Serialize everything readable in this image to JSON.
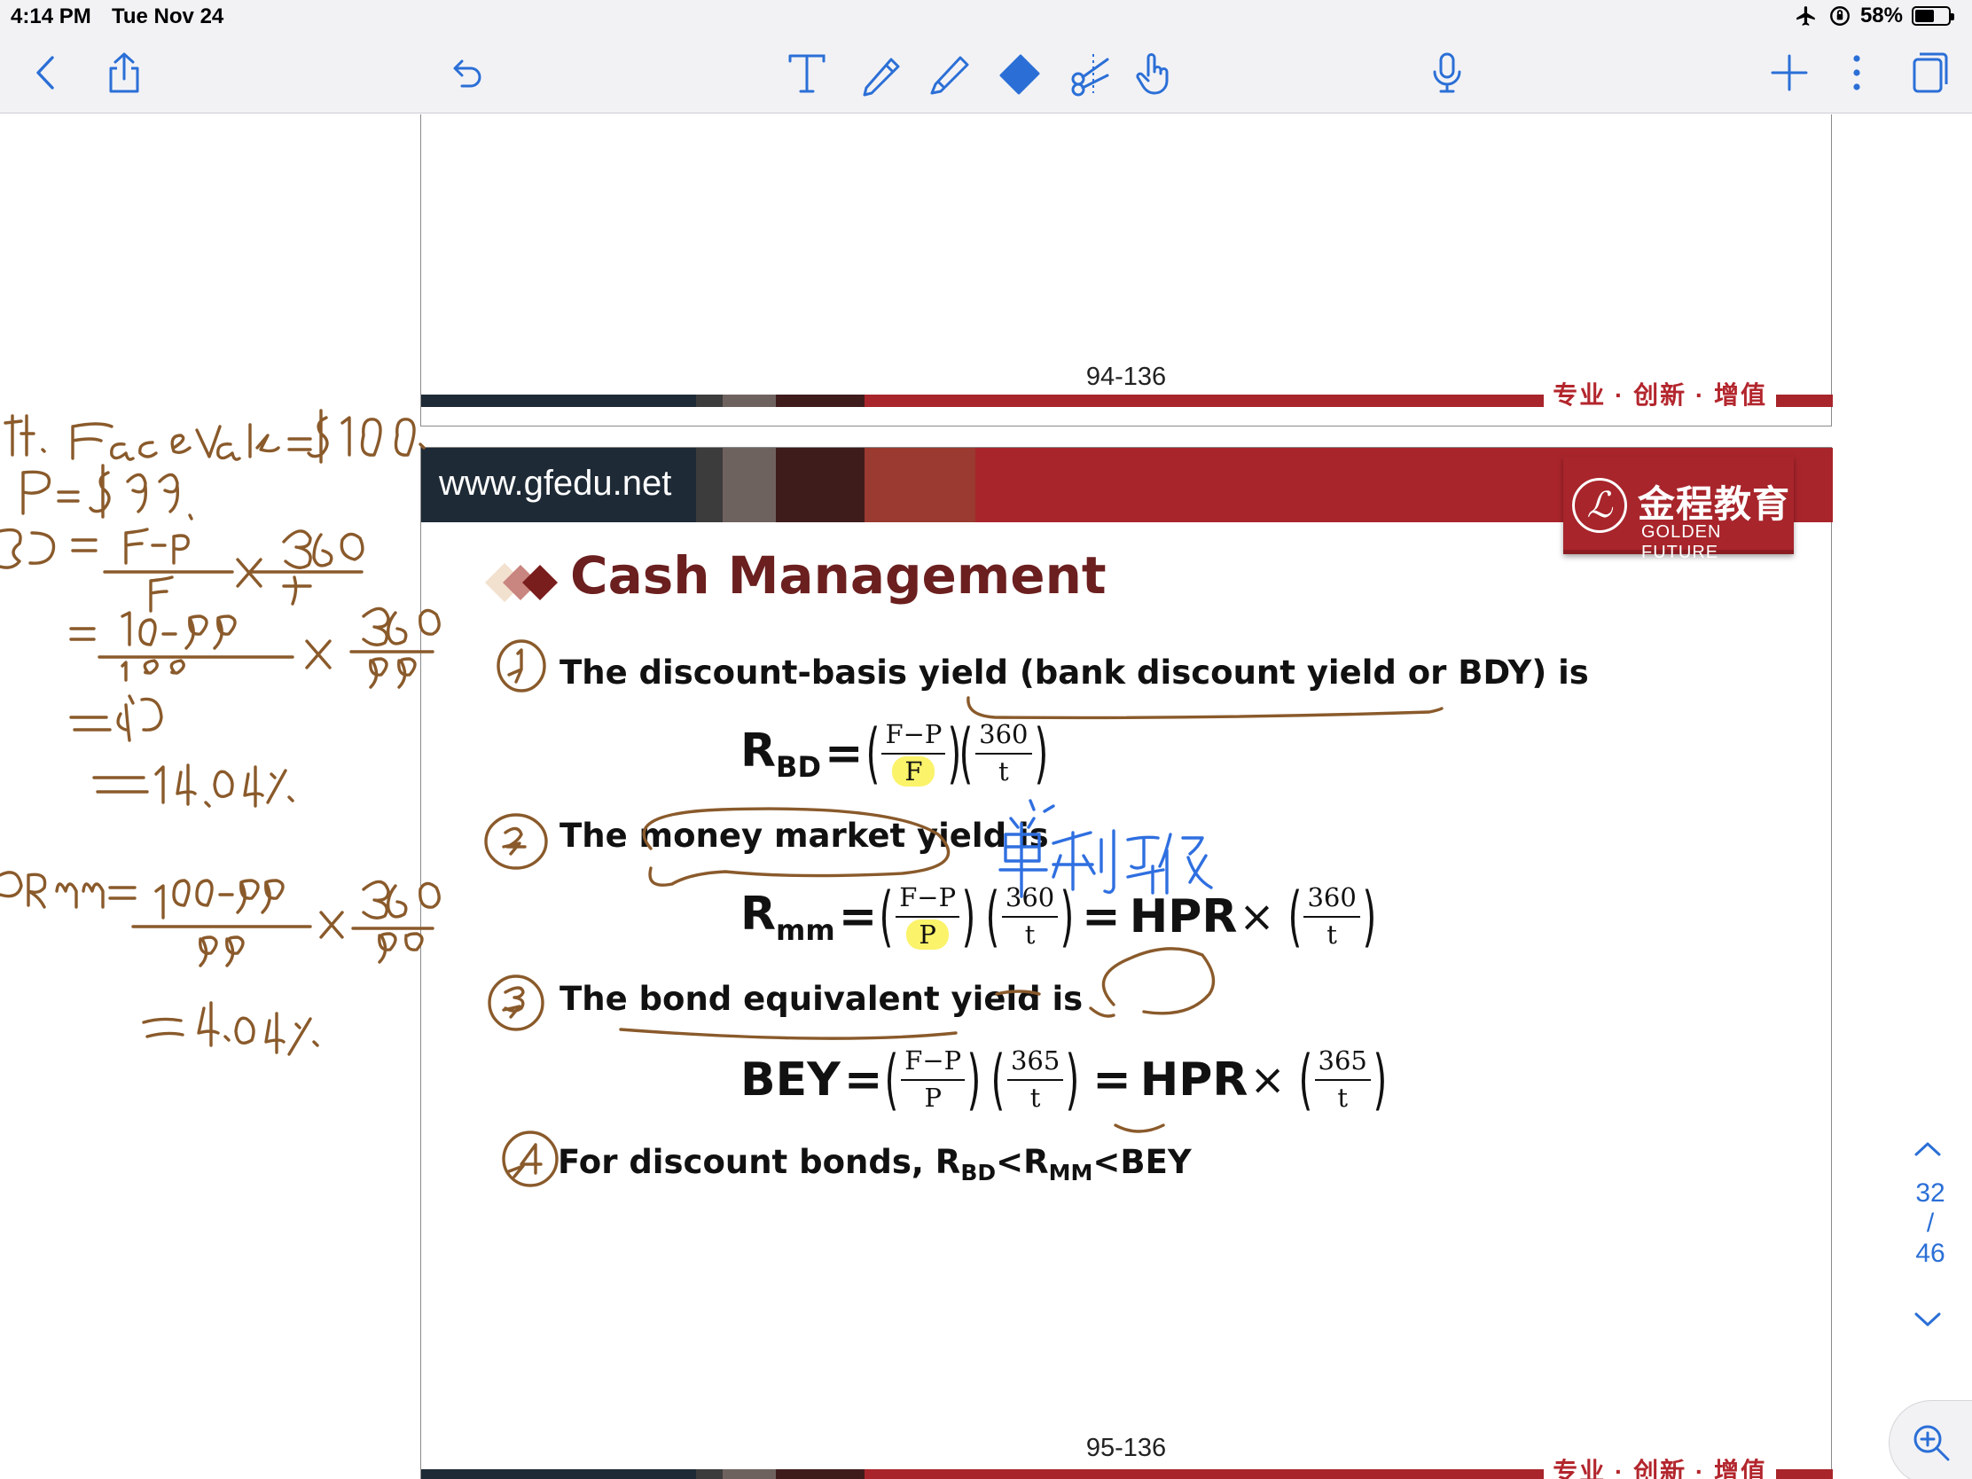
{
  "status": {
    "time": "4:14 PM",
    "date": "Tue Nov 24",
    "battery": "58%",
    "battery_level": 0.58
  },
  "toolbar": {
    "icons": [
      "back-icon",
      "share-icon",
      "undo-icon",
      "text-tool-icon",
      "pen-icon",
      "highlighter-icon",
      "eraser-icon",
      "lasso-icon",
      "hand-pointer-icon",
      "microphone-icon",
      "add-icon",
      "more-icon",
      "pages-icon"
    ]
  },
  "prev_page": {
    "page_number": "94-136",
    "slogan": "专业 · 创新 · 增值"
  },
  "slide": {
    "url": "www.gfedu.net",
    "logo_cn": "金程教育",
    "logo_en": "GOLDEN FUTURE",
    "title": "Cash Management",
    "bullet1": "The discount-basis yield (bank discount yield or BDY) is",
    "f1": {
      "lhs": "R",
      "sub": "BD",
      "eq": "=",
      "n1": "F−P",
      "d1": "F",
      "n2": "360",
      "d2": "t"
    },
    "bullet2": "The money market yield is",
    "f2": {
      "lhs": "R",
      "sub": "mm",
      "eq": "=",
      "n1": "F−P",
      "d1": "P",
      "n2": "360",
      "d2": "t",
      "eq2": "=",
      "hpr": "HPR",
      "times": "×",
      "n3": "360",
      "d3": "t"
    },
    "bullet3": "The bond equivalent yield is",
    "f3": {
      "lhs": "BEY",
      "eq": "=",
      "n1": "F−P",
      "d1": "P",
      "n2": "365",
      "d2": "t",
      "eq2": "=",
      "hpr": "HPR",
      "times": "×",
      "n3": "365",
      "d3": "t"
    },
    "bullet4_pre": "For discount bonds, R",
    "bullet4_sub1": "BD",
    "bullet4_mid": "<R",
    "bullet4_sub2": "MM",
    "bullet4_post": "<BEY",
    "page_number": "95-136",
    "slogan": "专业 · 创新 · 增值"
  },
  "navigator": {
    "current": "32",
    "sep": "/",
    "total": "46"
  },
  "colors": {
    "brand_red": "#a8252b",
    "title_maroon": "#6b1f1f",
    "ink_brown": "#8a5a2b",
    "ink_blue": "#2f6fe0",
    "highlight": "#fbf36a",
    "ios_blue": "#2b6fd6"
  }
}
